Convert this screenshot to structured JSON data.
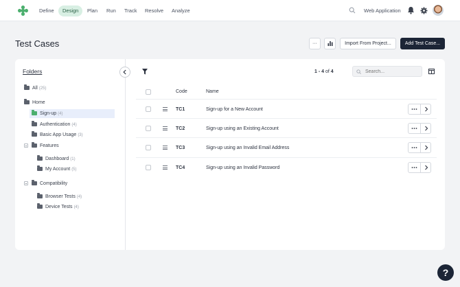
{
  "nav": {
    "items": [
      {
        "label": "Define"
      },
      {
        "label": "Design"
      },
      {
        "label": "Plan"
      },
      {
        "label": "Run"
      },
      {
        "label": "Track"
      },
      {
        "label": "Resolve"
      },
      {
        "label": "Analyze"
      }
    ],
    "active": "Design",
    "project": "Web Application",
    "brand_color": "#4caf6e"
  },
  "header": {
    "title": "Test Cases",
    "more_label": "···",
    "import_label": "Import From Project...",
    "add_label": "Add Test Case..."
  },
  "folders": {
    "title": "Folders",
    "items": [
      {
        "label": "All",
        "count": "(25)"
      },
      {
        "label": "Home",
        "count": ""
      },
      {
        "label": "Sign-up",
        "count": "(4)"
      },
      {
        "label": "Authentication",
        "count": "(4)"
      },
      {
        "label": "Basic App Usage",
        "count": "(3)"
      },
      {
        "label": "Features",
        "count": ""
      },
      {
        "label": "Dashboard",
        "count": "(1)"
      },
      {
        "label": "My Account",
        "count": "(5)"
      },
      {
        "label": "Compatibility",
        "count": ""
      },
      {
        "label": "Browser Tests",
        "count": "(4)"
      },
      {
        "label": "Device Tests",
        "count": "(4)"
      }
    ]
  },
  "table": {
    "range": "1 - 4",
    "of_label": "of",
    "total": "4",
    "search_placeholder": "Search...",
    "headers": {
      "code": "Code",
      "name": "Name"
    },
    "rows": [
      {
        "code": "TC1",
        "name": "Sign-up for a New Account"
      },
      {
        "code": "TC2",
        "name": "Sign-up using an Existing Account"
      },
      {
        "code": "TC3",
        "name": "Sign-up using an Invalid Email Address"
      },
      {
        "code": "TC4",
        "name": "Sign-up using an Invalid Password"
      }
    ]
  },
  "help": {
    "label": "?"
  }
}
